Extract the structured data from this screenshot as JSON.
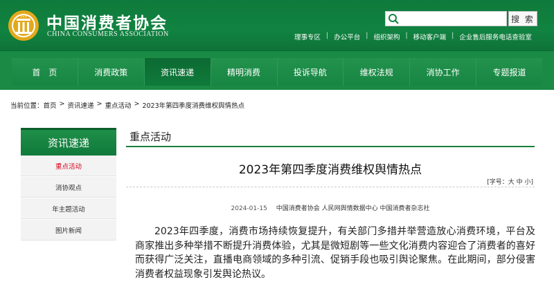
{
  "header": {
    "org_name_cn": "中国消费者协会",
    "org_name_en": "CHINA CONSUMERS ASSOCIATION",
    "search": {
      "placeholder": "",
      "button_label": "搜 索"
    },
    "top_links": [
      "理事专区",
      "办公平台",
      "组织架构",
      "移动客户端",
      "企业售后服务电话查验室"
    ]
  },
  "nav": {
    "items": [
      "首　页",
      "消费政策",
      "资讯速递",
      "精明消费",
      "投诉导航",
      "维权法规",
      "消协工作",
      "专题报道"
    ],
    "active_index": 2
  },
  "breadcrumb": {
    "prefix": "当前位置：",
    "items": [
      "首页",
      "资讯速递",
      "重点活动",
      "2023年第四季度消费维权舆情热点"
    ]
  },
  "sidebar": {
    "title": "资讯速递",
    "items": [
      "重点活动",
      "消协观点",
      "年主题活动",
      "图片新闻"
    ],
    "active_index": 0
  },
  "main": {
    "section_title": "重点活动",
    "article_title": "2023年第四季度消费维权舆情热点",
    "font_size_control": "[字号：大 中 小]",
    "date": "2024-01-15",
    "source": "中国消费者协会 人民网舆情数据中心 中国消费者杂志社",
    "body": "2023年四季度，消费市场持续恢复提升，有关部门多措并举营造放心消费环境，平台及商家推出多种举措不断提升消费体验，尤其是微短剧等一些文化消费内容迎合了消费者的喜好而获得广泛关注，直播电商领域的多种引流、促销手段也吸引舆论聚焦。在此期间，部分侵害消费者权益现象引发舆论热议。"
  },
  "colors": {
    "brand_green": "#118341",
    "nav_active": "#0c6a32",
    "sidebar_active_text": "#d8001a",
    "logo_gold": "#e3a91c"
  }
}
